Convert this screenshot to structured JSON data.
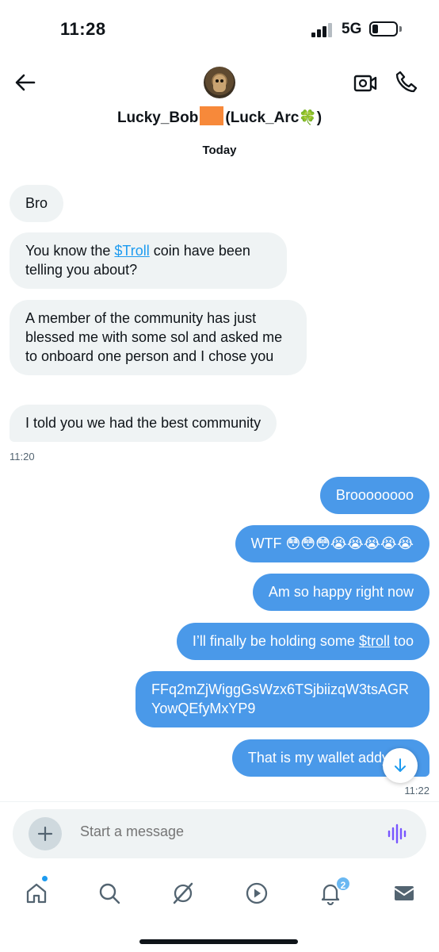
{
  "status_bar": {
    "time": "11:28",
    "network": "5G"
  },
  "header": {
    "contact_name_part1": "Lucky_Bob",
    "contact_name_part2": "(Luck_Arc",
    "contact_name_part3": ")",
    "clover_glyph": "🍀",
    "date_label": "Today"
  },
  "messages": [
    {
      "side": "in",
      "text": "Bro"
    },
    {
      "side": "in",
      "pre": "You know the ",
      "link": "$Troll",
      "post": " coin have been telling you about?"
    },
    {
      "side": "in",
      "text": "A member of the community has just blessed me with some sol and asked me to onboard one person and I chose you"
    },
    {
      "side": "in",
      "text": "I told you we had the best community"
    },
    {
      "side": "out",
      "text": "Broooooooo"
    },
    {
      "side": "out",
      "text": "WTF 😳😳😳😭😭😭😭😭"
    },
    {
      "side": "out",
      "text": "Am so happy right now"
    },
    {
      "side": "out",
      "pre": "I’ll finally be holding some ",
      "link": "$troll",
      "post": " too"
    },
    {
      "side": "out",
      "text": "FFq2mZjWiggGsWzx6TSjbiizqW3tsAGRYowQEfyMxYP9"
    },
    {
      "side": "out",
      "text": "That is my wallet addy bro"
    }
  ],
  "timestamps": {
    "incoming": "11:20",
    "outgoing": "11:22"
  },
  "composer": {
    "placeholder": "Start a message"
  },
  "nav": {
    "notification_count": "2"
  },
  "colors": {
    "accent": "#1d9bf0",
    "outgoing_bubble": "#4a99e9",
    "incoming_bubble": "#eff3f4"
  },
  "icons": [
    "back-arrow-icon",
    "video-call-icon",
    "phone-icon",
    "plus-icon",
    "voice-wave-icon",
    "home-icon",
    "search-icon",
    "grok-icon",
    "play-icon",
    "bell-icon",
    "mail-icon",
    "arrow-down-icon"
  ]
}
